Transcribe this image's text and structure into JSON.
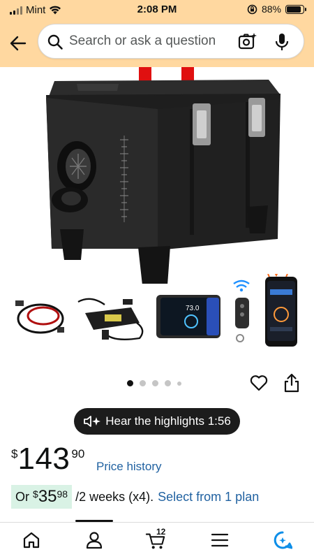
{
  "status_bar": {
    "carrier": "Mint",
    "time": "2:08 PM",
    "battery": "88%"
  },
  "search": {
    "placeholder": "Search or ask a question"
  },
  "product": {
    "image_icon": "diesel-air-heater-image",
    "thumbnails": [
      "cable-harness",
      "power-adapter",
      "lcd-controller",
      "remote-key-fob",
      "phone-app"
    ]
  },
  "carousel": {
    "total_dots": 5,
    "active_index": 0
  },
  "highlights": {
    "label": "Hear the highlights 1:56"
  },
  "price": {
    "symbol": "$",
    "whole": "143",
    "fraction": "90",
    "history_link": "Price history"
  },
  "installment": {
    "prefix": "Or",
    "symbol": "$",
    "whole": "35",
    "fraction": "98",
    "suffix": "/2 weeks (x4).",
    "link": "Select from 1 plan"
  },
  "bottom_nav": {
    "cart_count": "12",
    "items": [
      "home-icon",
      "account-icon",
      "cart-icon",
      "menu-icon",
      "rufus-icon"
    ]
  },
  "colors": {
    "header_bg": "#ffd8a0",
    "link": "#2162a1",
    "install_badge": "#d9f2e5"
  }
}
